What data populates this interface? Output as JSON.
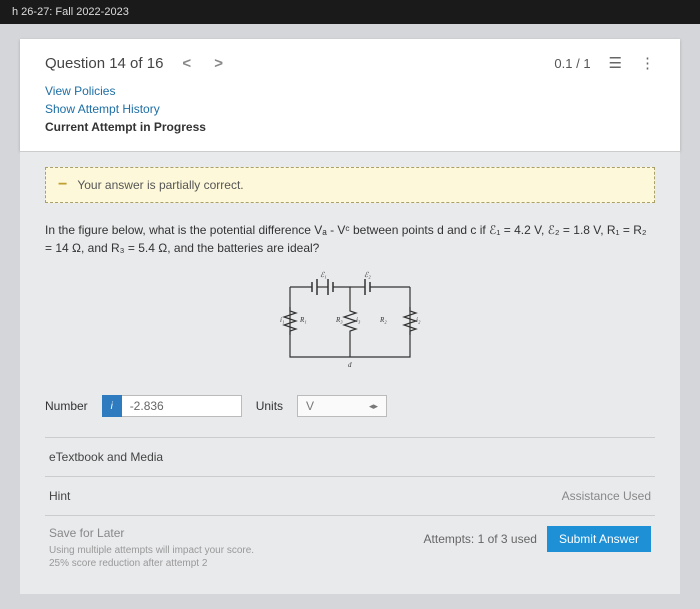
{
  "browser": {
    "tab": "h 26-27: Fall 2022-2023"
  },
  "header": {
    "title": "Question 14 of 16",
    "score": "0.1 / 1"
  },
  "links": {
    "policies": "View Policies",
    "history": "Show Attempt History",
    "current": "Current Attempt in Progress"
  },
  "feedback": "Your answer is partially correct.",
  "prompt": "In the figure below, what is the potential difference Vₐ - Vᶜ between points d and c if ℰ₁ = 4.2 V, ℰ₂ = 1.8 V, R₁ = R₂ = 14 Ω, and R₃ = 5.4 Ω, and the batteries are ideal?",
  "answer": {
    "number_label": "Number",
    "number_value": "-2.836",
    "units_label": "Units",
    "units_value": "V"
  },
  "sections": {
    "etextbook": "eTextbook and Media",
    "hint": "Hint",
    "assistance": "Assistance Used"
  },
  "footer": {
    "save": "Save for Later",
    "note": "Using multiple attempts will impact your score.\n25% score reduction after attempt 2",
    "attempts": "Attempts: 1 of 3 used",
    "submit": "Submit Answer"
  }
}
